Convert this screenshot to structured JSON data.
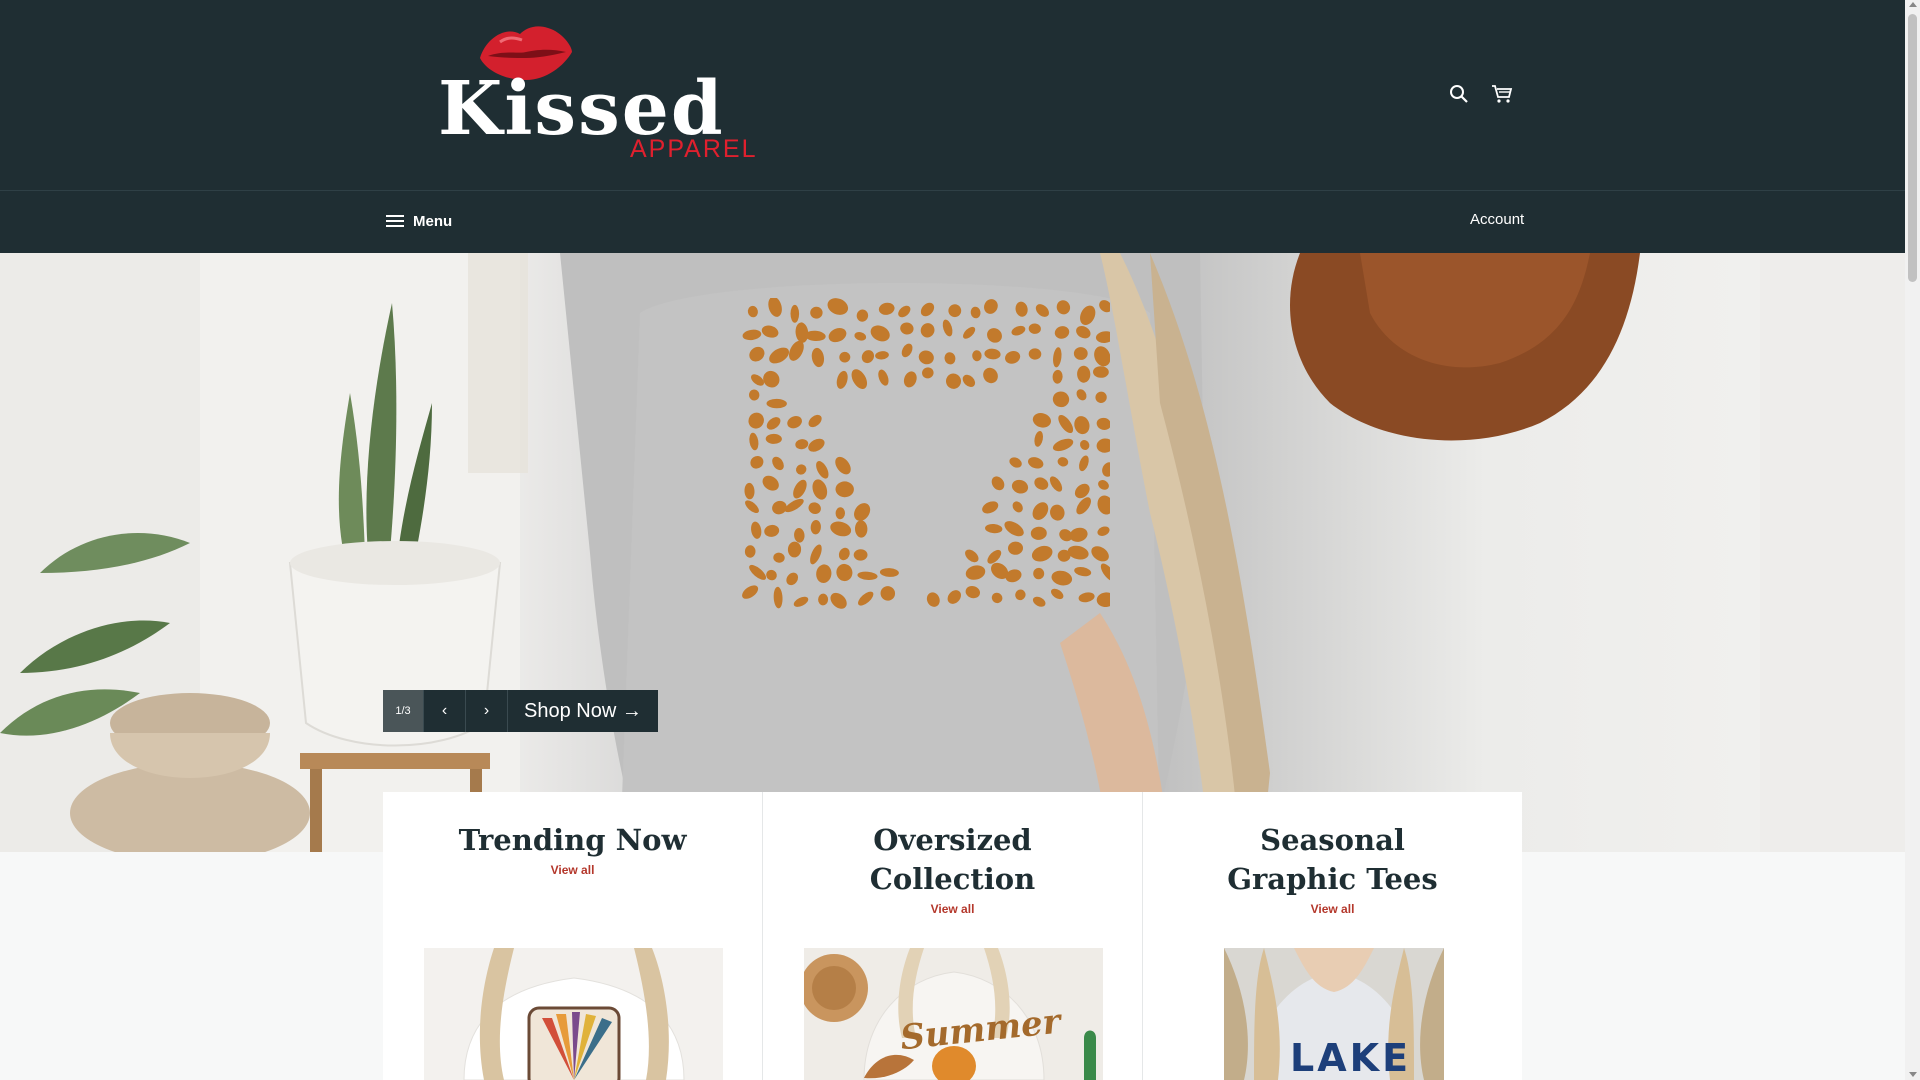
{
  "header": {
    "logo_text": "Kissed",
    "logo_sub": "APPAREL",
    "search_icon": "search-icon",
    "cart_icon": "cart-icon"
  },
  "nav": {
    "menu_label": "Menu",
    "menu_icon": "hamburger-icon",
    "account_label": "Account"
  },
  "hero": {
    "counter": "1/3",
    "prev_label": "‹",
    "next_label": "›",
    "cta_label": "Shop Now →"
  },
  "collections": [
    {
      "title": "Trending Now",
      "link": "View all"
    },
    {
      "title": "Oversized Collection",
      "link": "View all"
    },
    {
      "title": "Seasonal Graphic Tees",
      "link": "View all"
    }
  ],
  "colors": {
    "header_bg": "#1f2e33",
    "accent_red": "#e0202e",
    "link": "#b4372b",
    "leopard": "#c27a2c"
  }
}
